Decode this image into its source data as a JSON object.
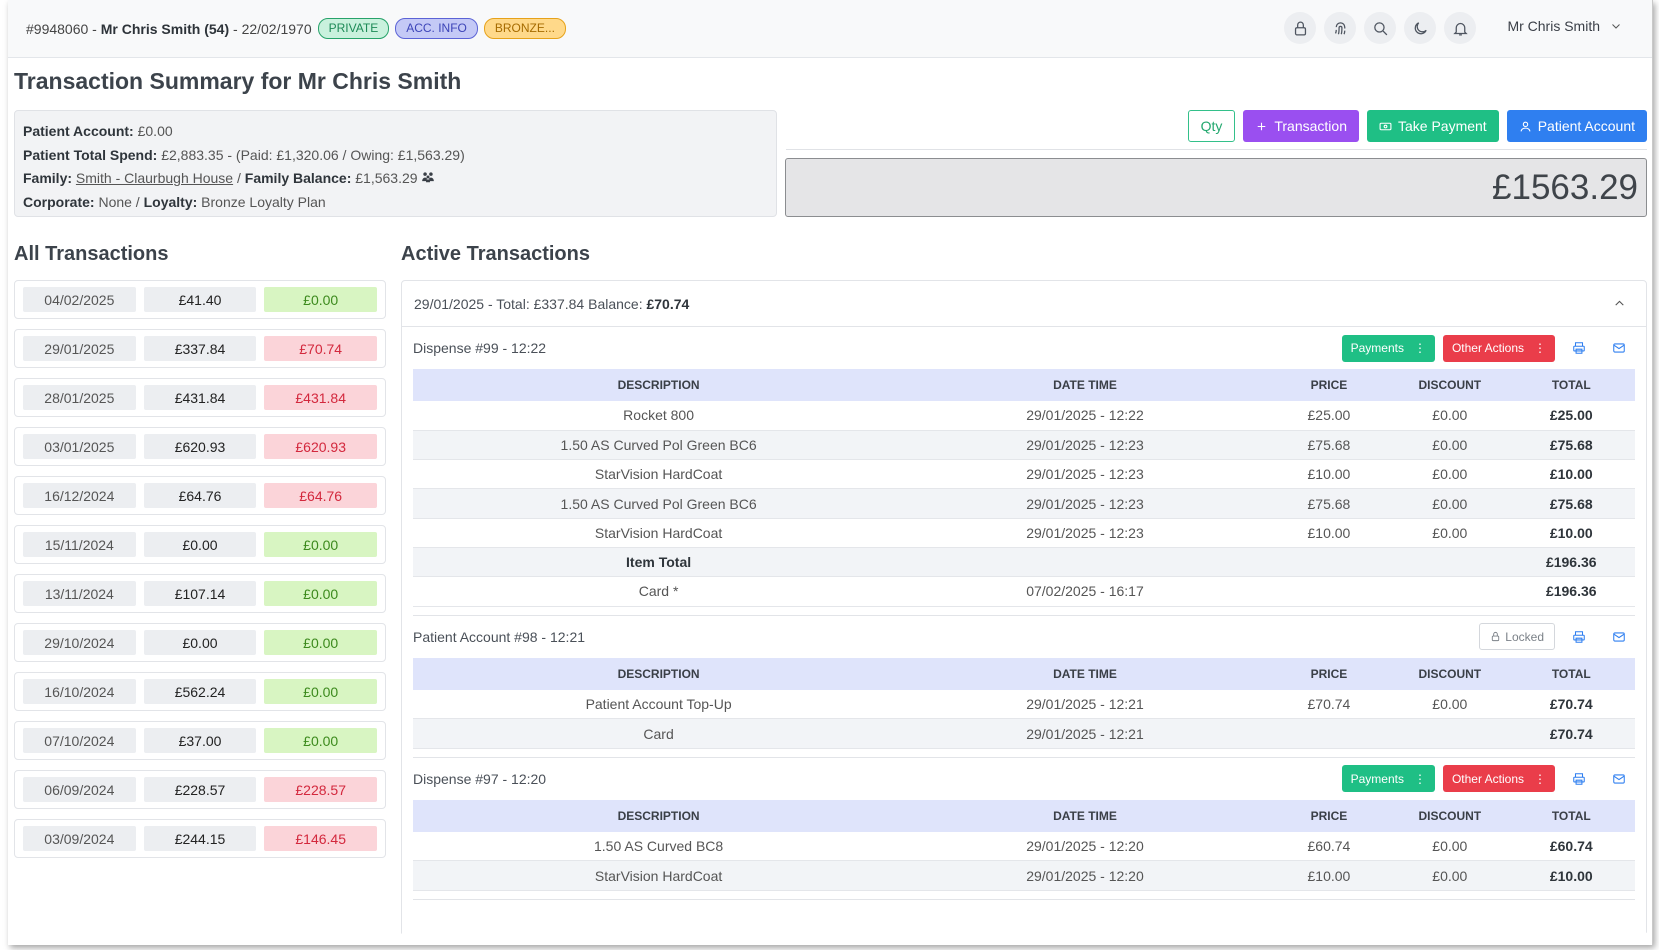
{
  "header": {
    "patient_id": "#9948060",
    "patient_name": "Mr Chris Smith (54)",
    "dob": "22/02/1970",
    "badges": [
      "PRIVATE",
      "ACC. INFO",
      "BRONZE..."
    ],
    "user_name": "Mr Chris Smith"
  },
  "page_title": "Transaction Summary for Mr Chris Smith",
  "info": {
    "patient_account_label": "Patient Account:",
    "patient_account_value": "£0.00",
    "total_spend_label": "Patient Total Spend:",
    "total_spend_value": "£2,883.35 - (Paid: £1,320.06 / Owing: £1,563.29)",
    "family_label": "Family:",
    "family_value": "Smith - Claurbugh House",
    "family_balance_label": "Family Balance:",
    "family_balance_value": "£1,563.29",
    "corporate_label": "Corporate:",
    "corporate_value": "None",
    "loyalty_label": "Loyalty:",
    "loyalty_value": "Bronze Loyalty Plan"
  },
  "actions": {
    "qty": "Qty",
    "transaction": "Transaction",
    "take_payment": "Take Payment",
    "patient_account": "Patient Account"
  },
  "balance": "£1563.29",
  "all_transactions": {
    "title": "All Transactions",
    "rows": [
      {
        "date": "04/02/2025",
        "amount": "£41.40",
        "balance": "£0.00",
        "status": "ok"
      },
      {
        "date": "29/01/2025",
        "amount": "£337.84",
        "balance": "£70.74",
        "status": "due"
      },
      {
        "date": "28/01/2025",
        "amount": "£431.84",
        "balance": "£431.84",
        "status": "due"
      },
      {
        "date": "03/01/2025",
        "amount": "£620.93",
        "balance": "£620.93",
        "status": "due"
      },
      {
        "date": "16/12/2024",
        "amount": "£64.76",
        "balance": "£64.76",
        "status": "due"
      },
      {
        "date": "15/11/2024",
        "amount": "£0.00",
        "balance": "£0.00",
        "status": "ok"
      },
      {
        "date": "13/11/2024",
        "amount": "£107.14",
        "balance": "£0.00",
        "status": "ok"
      },
      {
        "date": "29/10/2024",
        "amount": "£0.00",
        "balance": "£0.00",
        "status": "ok"
      },
      {
        "date": "16/10/2024",
        "amount": "£562.24",
        "balance": "£0.00",
        "status": "ok"
      },
      {
        "date": "07/10/2024",
        "amount": "£37.00",
        "balance": "£0.00",
        "status": "ok"
      },
      {
        "date": "06/09/2024",
        "amount": "£228.57",
        "balance": "£228.57",
        "status": "due"
      },
      {
        "date": "03/09/2024",
        "amount": "£244.15",
        "balance": "£146.45",
        "status": "due"
      }
    ]
  },
  "active": {
    "title": "Active Transactions",
    "summary_prefix": "29/01/2025 - Total: £337.84 Balance:",
    "summary_balance": "£70.74",
    "columns": [
      "DESCRIPTION",
      "DATE TIME",
      "PRICE",
      "DISCOUNT",
      "TOTAL"
    ],
    "payments_label": "Payments",
    "other_actions_label": "Other Actions",
    "locked_label": "Locked",
    "sections": [
      {
        "title": "Dispense #99 - 12:22",
        "kind": "dispense",
        "rows": [
          {
            "desc": "Rocket 800",
            "dt": "29/01/2025 - 12:22",
            "price": "£25.00",
            "disc": "£0.00",
            "total": "£25.00"
          },
          {
            "desc": "1.50 AS Curved Pol Green BC6",
            "dt": "29/01/2025 - 12:23",
            "price": "£75.68",
            "disc": "£0.00",
            "total": "£75.68"
          },
          {
            "desc": "StarVision HardCoat",
            "dt": "29/01/2025 - 12:23",
            "price": "£10.00",
            "disc": "£0.00",
            "total": "£10.00"
          },
          {
            "desc": "1.50 AS Curved Pol Green BC6",
            "dt": "29/01/2025 - 12:23",
            "price": "£75.68",
            "disc": "£0.00",
            "total": "£75.68"
          },
          {
            "desc": "StarVision HardCoat",
            "dt": "29/01/2025 - 12:23",
            "price": "£10.00",
            "disc": "£0.00",
            "total": "£10.00"
          },
          {
            "desc": "Item Total",
            "dt": "",
            "price": "",
            "disc": "",
            "total": "£196.36",
            "bold": true
          },
          {
            "desc": "Card *",
            "dt": "07/02/2025 - 16:17",
            "price": "",
            "disc": "",
            "total": "£196.36"
          }
        ]
      },
      {
        "title": "Patient Account #98 - 12:21",
        "kind": "locked",
        "rows": [
          {
            "desc": "Patient Account Top-Up",
            "dt": "29/01/2025 - 12:21",
            "price": "£70.74",
            "disc": "£0.00",
            "total": "£70.74"
          },
          {
            "desc": "Card",
            "dt": "29/01/2025 - 12:21",
            "price": "",
            "disc": "",
            "total": "£70.74"
          }
        ]
      },
      {
        "title": "Dispense #97 - 12:20",
        "kind": "dispense",
        "rows": [
          {
            "desc": "1.50 AS Curved BC8",
            "dt": "29/01/2025 - 12:20",
            "price": "£60.74",
            "disc": "£0.00",
            "total": "£60.74"
          },
          {
            "desc": "StarVision HardCoat",
            "dt": "29/01/2025 - 12:20",
            "price": "£10.00",
            "disc": "£0.00",
            "total": "£10.00"
          }
        ]
      }
    ]
  },
  "colors": {
    "green": "#1fbf85",
    "purple": "#9a4ff0",
    "blue": "#2f7ff0",
    "red": "#ea3d4a"
  }
}
